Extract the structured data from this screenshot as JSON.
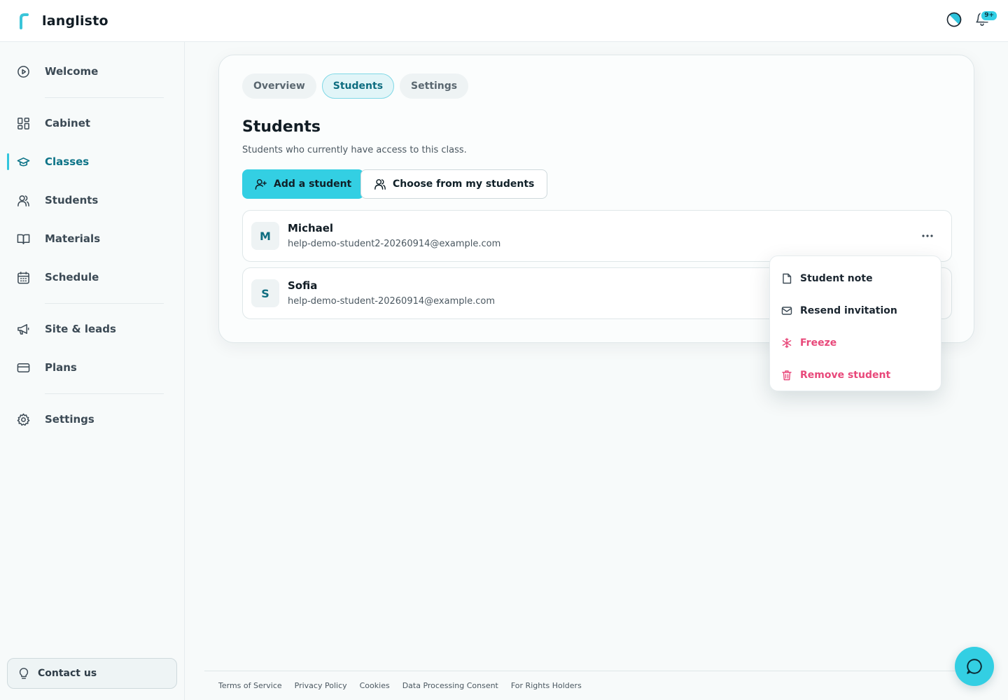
{
  "app": {
    "name": "langlisto"
  },
  "header": {
    "notifications_badge": "9+"
  },
  "sidebar": {
    "items": [
      {
        "label": "Welcome",
        "icon": "play-circle-icon"
      },
      {
        "label": "Cabinet",
        "icon": "dashboard-icon"
      },
      {
        "label": "Classes",
        "icon": "graduation-cap-icon",
        "active": true
      },
      {
        "label": "Students",
        "icon": "users-icon"
      },
      {
        "label": "Materials",
        "icon": "book-icon"
      },
      {
        "label": "Schedule",
        "icon": "calendar-icon"
      },
      {
        "label": "Site & leads",
        "icon": "megaphone-icon"
      },
      {
        "label": "Plans",
        "icon": "credit-card-icon"
      },
      {
        "label": "Settings",
        "icon": "gear-icon"
      }
    ],
    "contact_label": "Contact us"
  },
  "tabs": [
    {
      "label": "Overview"
    },
    {
      "label": "Students",
      "active": true
    },
    {
      "label": "Settings"
    }
  ],
  "section": {
    "title": "Students",
    "subtitle": "Students who currently have access to this class.",
    "add_button": "Add a student",
    "choose_button": "Choose from my students"
  },
  "students": [
    {
      "initial": "M",
      "name": "Michael",
      "email": "help-demo-student2-20260914@example.com"
    },
    {
      "initial": "S",
      "name": "Sofia",
      "email": "help-demo-student-20260914@example.com"
    }
  ],
  "menu": {
    "items": [
      {
        "label": "Student note",
        "icon": "note-icon"
      },
      {
        "label": "Resend invitation",
        "icon": "mail-icon"
      },
      {
        "label": "Freeze",
        "icon": "snowflake-icon",
        "danger": true
      },
      {
        "label": "Remove student",
        "icon": "trash-icon",
        "danger": true
      }
    ]
  },
  "footer": {
    "links": [
      "Terms of Service",
      "Privacy Policy",
      "Cookies",
      "Data Processing Consent",
      "For Rights Holders"
    ]
  },
  "colors": {
    "accent": "#33cfe3",
    "active_text": "#0e7488",
    "danger": "#e8487a"
  }
}
